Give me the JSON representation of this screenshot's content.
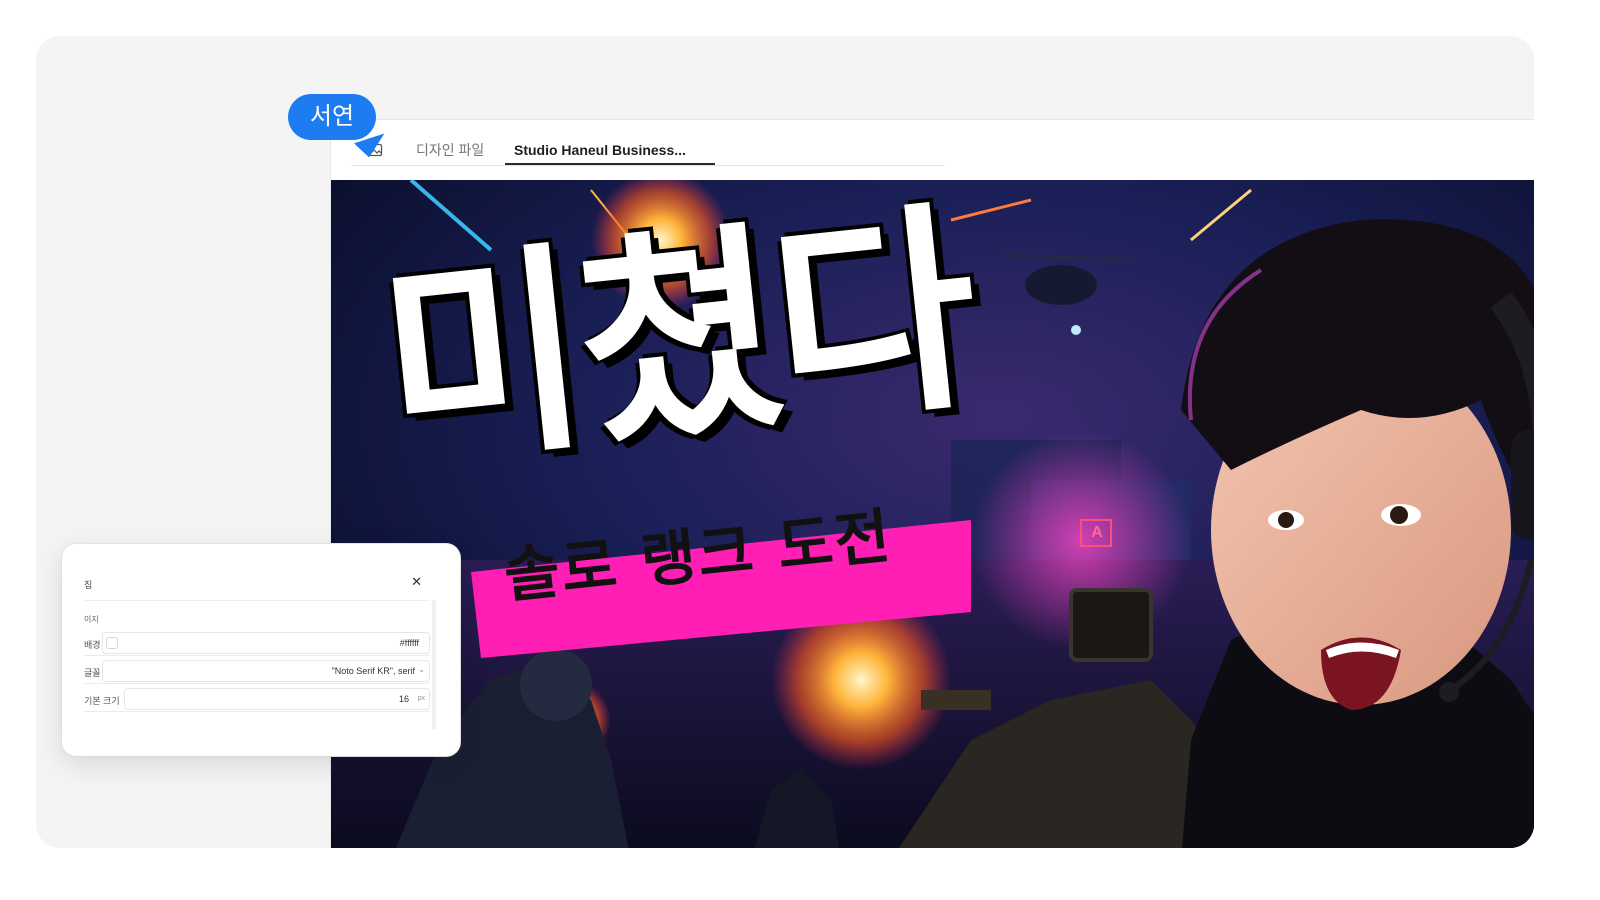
{
  "tabs": {
    "home_icon": "image-icon",
    "files_label": "디자인 파일",
    "active_label": "Studio Haneul Business..."
  },
  "collaborator": {
    "name": "서연",
    "color": "#1d7cf2"
  },
  "thumbnail": {
    "headline": "미쳤다",
    "subheadline": "솔로 랭크 도전",
    "badge": "A",
    "accent": "#ff1fb4"
  },
  "panel": {
    "title": "집",
    "section": "이지",
    "close_icon": "close-icon",
    "background_label": "배경",
    "background_value": "#ffffff",
    "font_label": "글꼴",
    "font_value": "\"Noto Serif KR\", serif",
    "size_label": "기본 크기",
    "size_value": "16",
    "size_unit": "px"
  }
}
